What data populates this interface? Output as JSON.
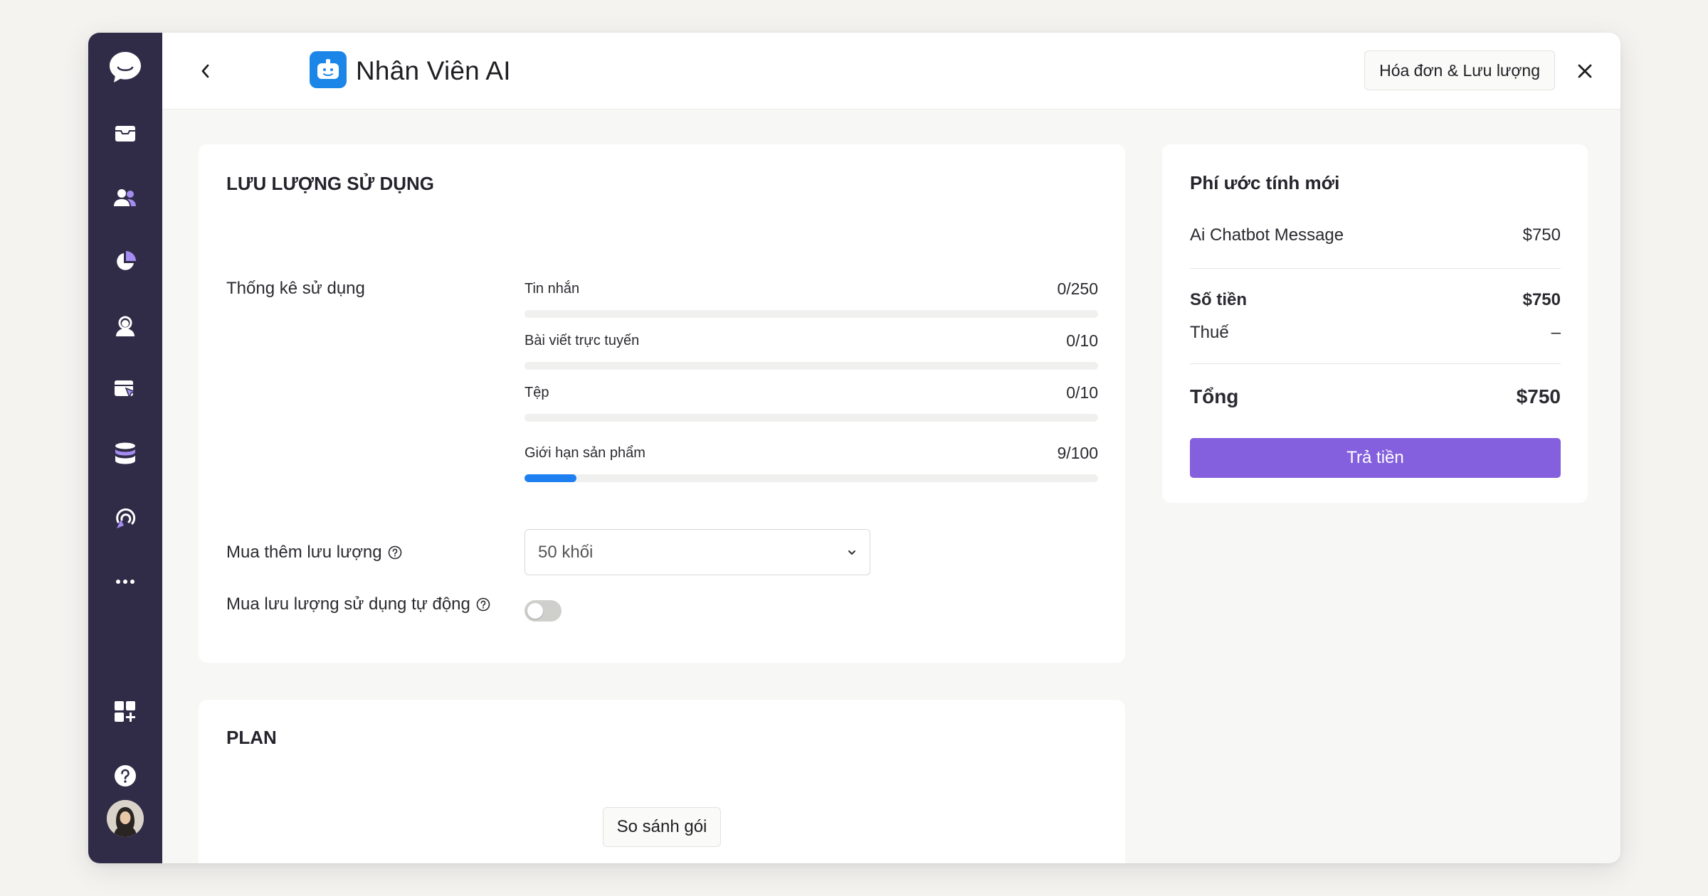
{
  "colors": {
    "sidebar": "#302c48",
    "accent": "#8460de",
    "progress": "#1e7ff0",
    "app_icon": "#1b86e8"
  },
  "sidebar": {
    "items": [
      {
        "icon": "chat-bubble-logo-icon"
      },
      {
        "icon": "inbox-icon"
      },
      {
        "icon": "contacts-icon"
      },
      {
        "icon": "pie-chart-icon"
      },
      {
        "icon": "agent-icon"
      },
      {
        "icon": "web-click-icon"
      },
      {
        "icon": "database-icon"
      },
      {
        "icon": "broadcast-icon"
      },
      {
        "icon": "more-icon"
      },
      {
        "icon": "apps-add-icon"
      },
      {
        "icon": "help-icon"
      }
    ]
  },
  "header": {
    "title": "Nhân Viên AI",
    "billing_button": "Hóa đơn & Lưu lượng"
  },
  "usage": {
    "title": "LƯU LƯỢNG SỬ DỤNG",
    "stats_label": "Thống kê sử dụng",
    "stats": [
      {
        "name": "Tin nhắn",
        "value": "0/250",
        "fraction": 0
      },
      {
        "name": "Bài viết trực tuyến",
        "value": "0/10",
        "fraction": 0
      },
      {
        "name": "Tệp",
        "value": "0/10",
        "fraction": 0
      },
      {
        "name": "Giới hạn sản phẩm",
        "value": "9/100",
        "fraction": 0.09
      }
    ],
    "buy_more_label": "Mua thêm lưu lượng",
    "buy_more_value": "50 khối",
    "auto_buy_label": "Mua lưu lượng sử dụng tự động",
    "auto_buy_enabled": false
  },
  "plan": {
    "title": "PLAN",
    "compare_button": "So sánh gói"
  },
  "fee": {
    "title": "Phí ước tính mới",
    "item_name": "Ai Chatbot Message",
    "item_price": "$750",
    "amount_label": "Số tiền",
    "amount_value": "$750",
    "tax_label": "Thuế",
    "tax_value": "–",
    "total_label": "Tổng",
    "total_value": "$750",
    "pay_button": "Trả tiền"
  }
}
